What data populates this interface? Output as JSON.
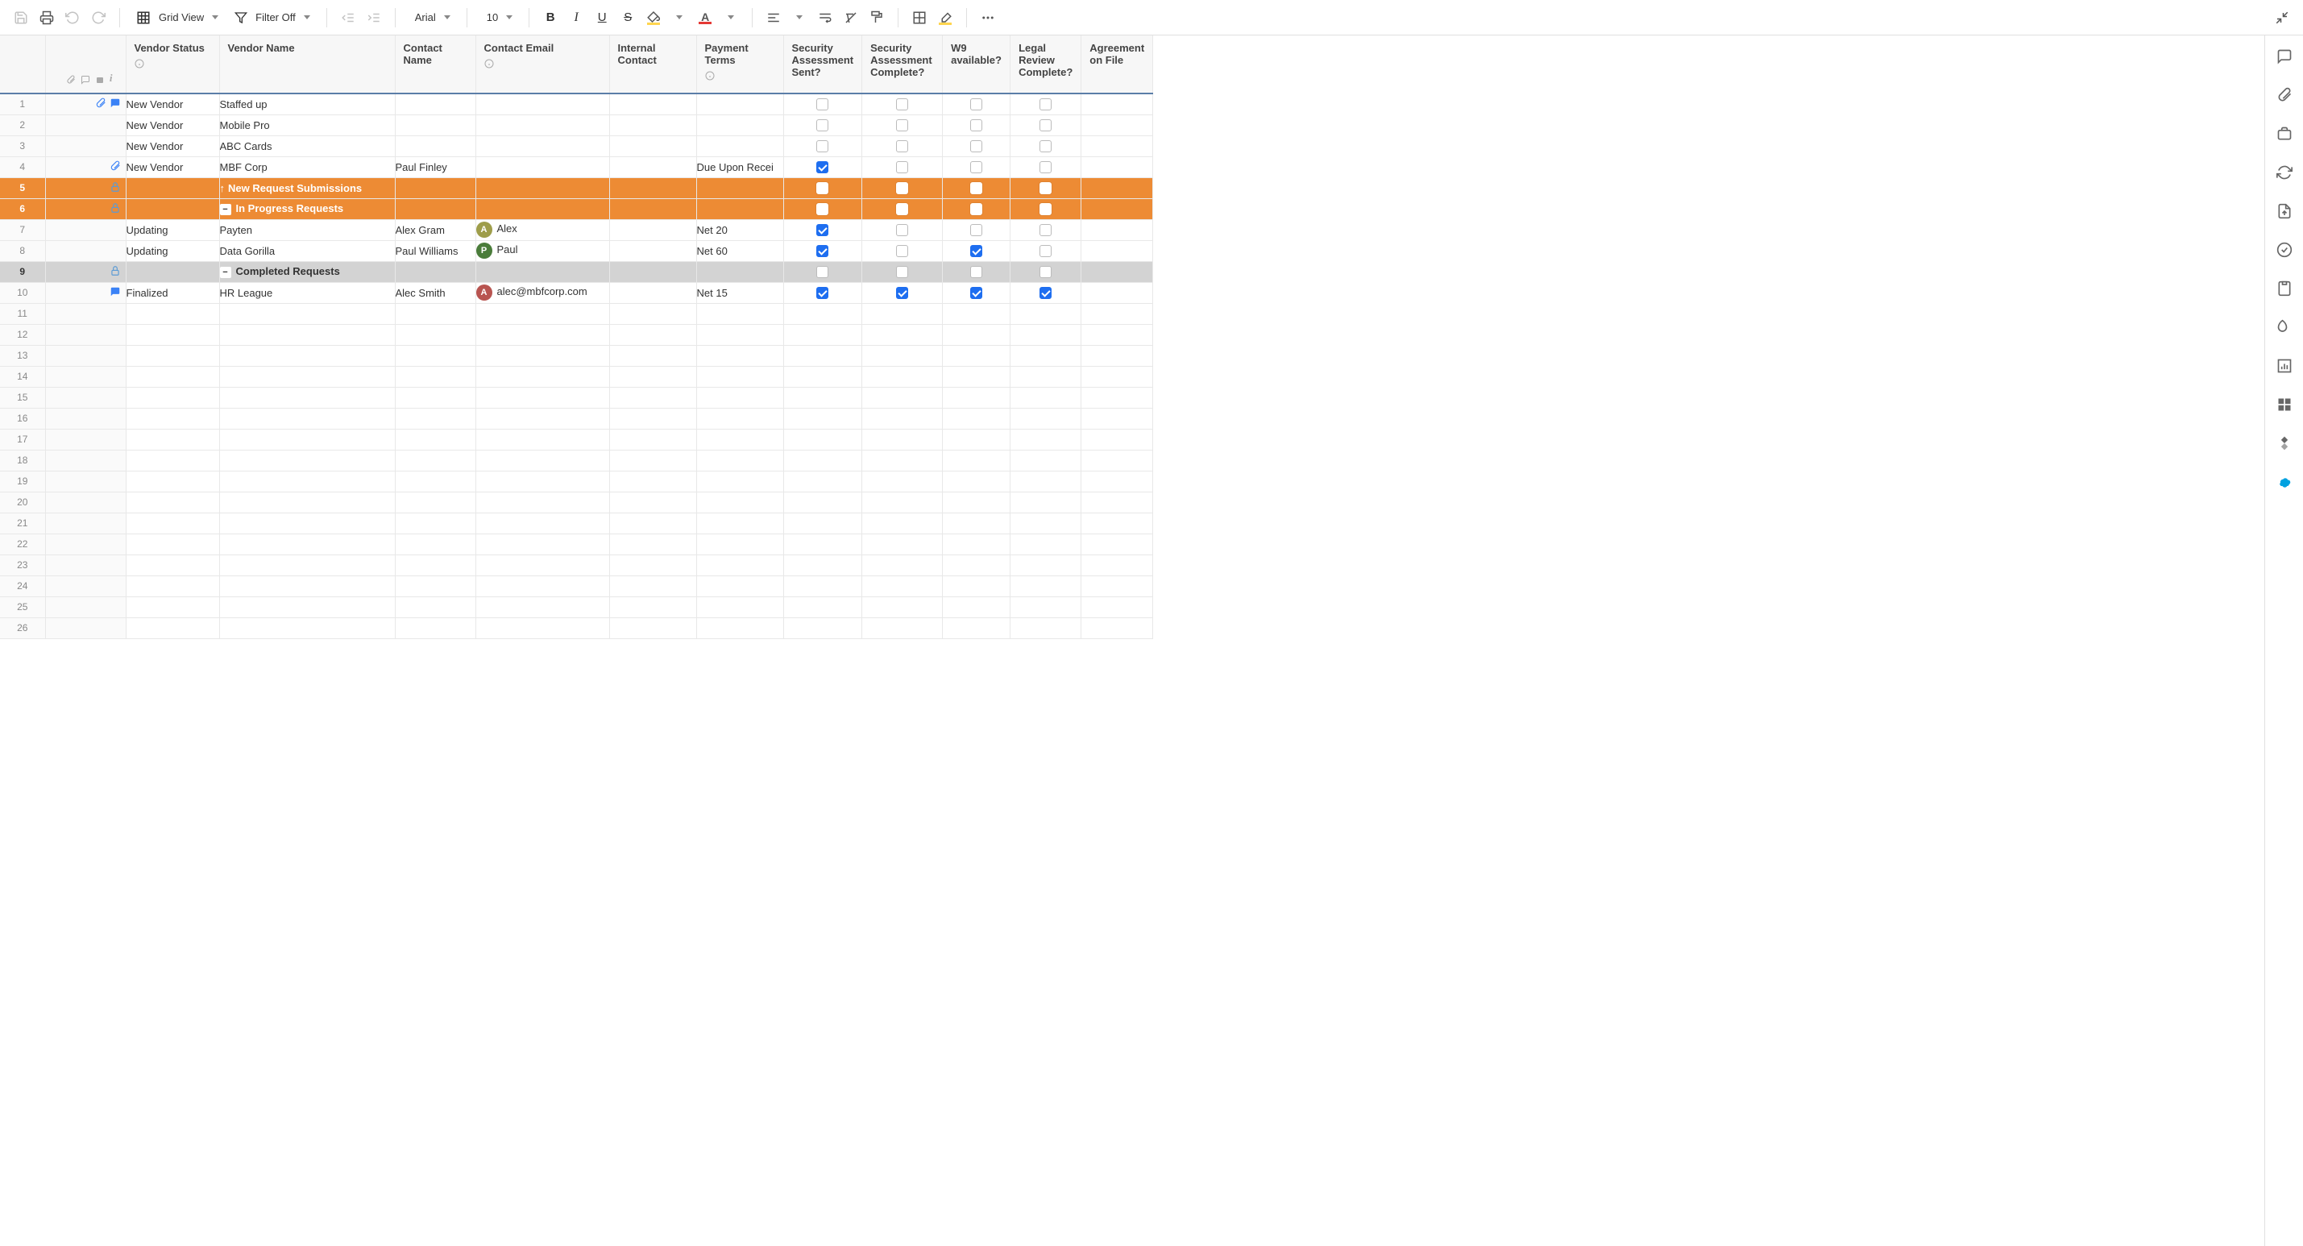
{
  "toolbar": {
    "grid_view_label": "Grid View",
    "filter_label": "Filter Off",
    "font_name": "Arial",
    "font_size": "10"
  },
  "columns": {
    "vendor_status": "Vendor Status",
    "vendor_name": "Vendor Name",
    "contact_name": "Contact Name",
    "contact_email": "Contact Email",
    "internal_contact": "Internal Contact",
    "payment_terms": "Payment Terms",
    "security_sent": "Security Assessment Sent?",
    "security_complete": "Security Assessment Complete?",
    "w9": "W9 available?",
    "legal_review": "Legal Review Complete?",
    "agreement": "Agreement on File"
  },
  "rows": [
    {
      "n": "1",
      "icons": [
        "attach",
        "comment"
      ],
      "status": "New Vendor",
      "name": "Staffed up",
      "contact": "",
      "email": "",
      "internal": "",
      "terms": "",
      "sa": false,
      "sc": false,
      "w9": false,
      "lr": false
    },
    {
      "n": "2",
      "icons": [],
      "status": "New Vendor",
      "name": "Mobile Pro",
      "contact": "",
      "email": "",
      "internal": "",
      "terms": "",
      "sa": false,
      "sc": false,
      "w9": false,
      "lr": false
    },
    {
      "n": "3",
      "icons": [],
      "status": "New Vendor",
      "name": "ABC Cards",
      "contact": "",
      "email": "",
      "internal": "",
      "terms": "",
      "sa": false,
      "sc": false,
      "w9": false,
      "lr": false
    },
    {
      "n": "4",
      "icons": [
        "attach"
      ],
      "status": "New Vendor",
      "name": "MBF Corp",
      "contact": "Paul Finley",
      "email": "",
      "internal": "",
      "terms": "Due Upon Recei",
      "sa": true,
      "sc": false,
      "w9": false,
      "lr": false
    },
    {
      "n": "5",
      "type": "section-orange",
      "icons": [
        "lock"
      ],
      "name": "New Request Submissions",
      "arrow": true
    },
    {
      "n": "6",
      "type": "section-orange",
      "icons": [
        "lock"
      ],
      "name": "In Progress Requests",
      "collapse": true
    },
    {
      "n": "7",
      "icons": [],
      "status": "Updating",
      "name": "Payten",
      "indent": 2,
      "contact": "Alex Gram",
      "email": "Alex",
      "avatar": "A",
      "avclass": "av-ol",
      "internal": "",
      "terms": "Net 20",
      "sa": true,
      "sc": false,
      "w9": false,
      "lr": false
    },
    {
      "n": "8",
      "icons": [],
      "status": "Updating",
      "name": "Data Gorilla",
      "indent": 2,
      "contact": "Paul Williams",
      "email": "Paul",
      "avatar": "P",
      "avclass": "av-gr",
      "internal": "",
      "terms": "Net 60",
      "sa": true,
      "sc": false,
      "w9": true,
      "lr": false
    },
    {
      "n": "9",
      "type": "section-grey",
      "icons": [
        "lock"
      ],
      "name": "Completed Requests",
      "collapse": true
    },
    {
      "n": "10",
      "icons": [
        "comment"
      ],
      "status": "Finalized",
      "name": "HR League",
      "indent": 2,
      "contact": "Alec Smith",
      "email": "alec@mbfcorp.com",
      "avatar": "A",
      "avclass": "av-rd",
      "internal": "",
      "terms": "Net 15",
      "sa": true,
      "sc": true,
      "w9": true,
      "lr": true
    }
  ],
  "empty_rows": [
    "11",
    "12",
    "13",
    "14",
    "15",
    "16",
    "17",
    "18",
    "19",
    "20",
    "21",
    "22",
    "23",
    "24",
    "25",
    "26"
  ]
}
